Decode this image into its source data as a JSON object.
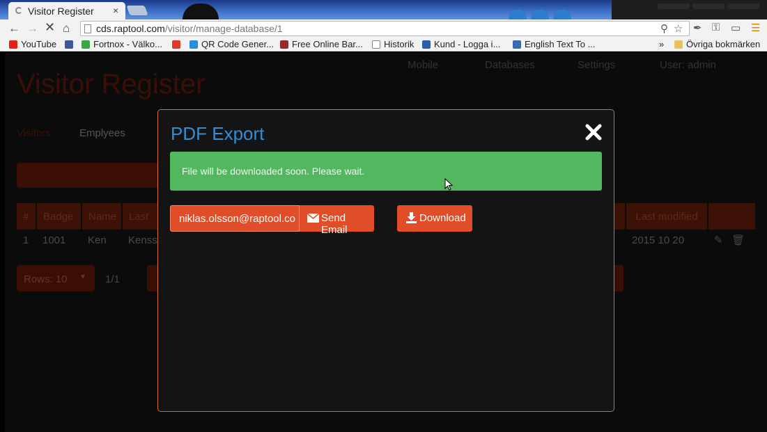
{
  "browser": {
    "tab_title": "Visitor Register",
    "tab_close": "×",
    "url_host": "cds.raptool.com",
    "url_path": "/visitor/manage-database/1",
    "bookmarks": [
      {
        "label": "YouTube",
        "color": "#e62117"
      },
      {
        "label": "Fortnox - Välko...",
        "color": "#2a5fb0"
      },
      {
        "label": "",
        "color": "#e03a2a"
      },
      {
        "label": "QR Code Gener...",
        "color": "#2a8fd8"
      },
      {
        "label": "Free Online Bar...",
        "color": "#9a2a2a"
      },
      {
        "label": "Historik",
        "color": "#ffffff"
      },
      {
        "label": "Kund - Logga i...",
        "color": "#2a5fb0"
      },
      {
        "label": "English Text To ...",
        "color": "#3a6ab0"
      }
    ],
    "bookmarks_overflow": "»",
    "other_bookmarks": "Övriga bokmärken"
  },
  "page": {
    "brand": "Visitor Register",
    "nav": [
      "Mobile",
      "Databases",
      "Settings",
      "User: admin"
    ],
    "subtabs": [
      "Visitors",
      "Emplyees"
    ],
    "table": {
      "headers": [
        "#",
        "Badge",
        "Name",
        "Last",
        "Last modified"
      ],
      "row": {
        "num": "1",
        "badge": "1001",
        "name": "Ken",
        "last": "Kensso",
        "modified": "2015 10 20"
      }
    },
    "rows_label": "Rows: 10",
    "page_num": "1/1"
  },
  "modal": {
    "title": "PDF Export",
    "alert": "File will be downloaded soon. Please wait.",
    "email": "niklas.olsson@raptool.co",
    "send_label": "Send Email",
    "download_label": "Download",
    "accent": "#e14d28",
    "success": "#53b760",
    "title_color": "#2f8fd8"
  }
}
